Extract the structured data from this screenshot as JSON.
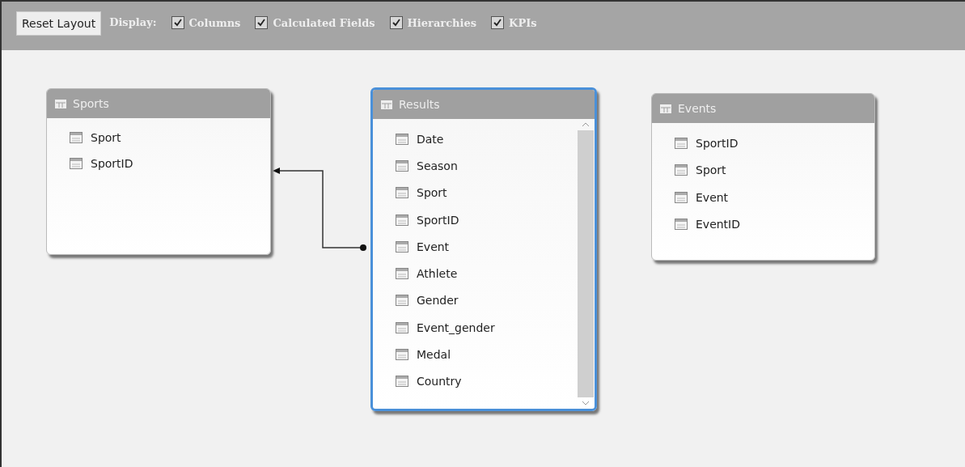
{
  "toolbar": {
    "reset_button": "Reset Layout",
    "display_label": "Display:",
    "options": [
      {
        "label": "Columns",
        "checked": true
      },
      {
        "label": "Calculated Fields",
        "checked": true
      },
      {
        "label": "Hierarchies",
        "checked": true
      },
      {
        "label": "KPIs",
        "checked": true
      }
    ]
  },
  "tables": [
    {
      "name": "Sports",
      "selected": false,
      "columns": [
        "Sport",
        "SportID"
      ],
      "scrollbar": false
    },
    {
      "name": "Results",
      "selected": true,
      "columns": [
        "Date",
        "Season",
        "Sport",
        "SportID",
        "Event",
        "Athlete",
        "Gender",
        "Event_gender",
        "Medal",
        "Country"
      ],
      "scrollbar": true
    },
    {
      "name": "Events",
      "selected": false,
      "columns": [
        "SportID",
        "Sport",
        "Event",
        "EventID"
      ],
      "scrollbar": false
    }
  ]
}
